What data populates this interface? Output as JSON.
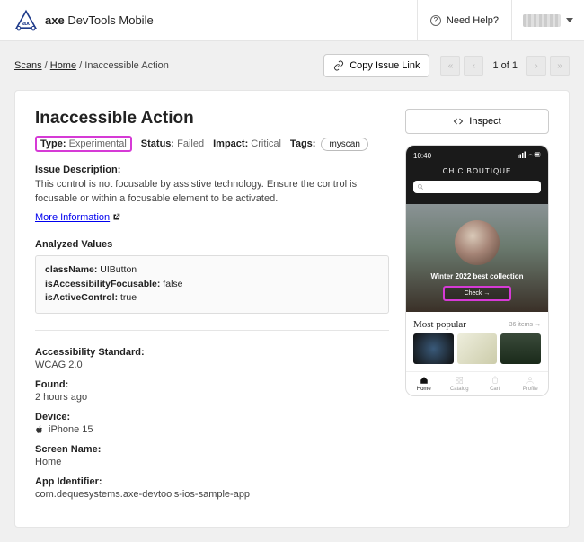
{
  "brand": {
    "strong": "axe",
    "light": " DevTools Mobile"
  },
  "help": {
    "label": "Need Help?"
  },
  "breadcrumbs": {
    "scans": "Scans",
    "home": "Home",
    "current": "Inaccessible Action",
    "sep": " / "
  },
  "actions": {
    "copy": "Copy Issue Link",
    "inspect": "Inspect"
  },
  "pager": {
    "label": "1 of 1"
  },
  "issue": {
    "title": "Inaccessible Action",
    "type_label": "Type:",
    "type_val": "Experimental",
    "status_label": "Status:",
    "status_val": "Failed",
    "impact_label": "Impact:",
    "impact_val": "Critical",
    "tags_label": "Tags:",
    "tag1": "myscan",
    "desc_hd": "Issue Description:",
    "desc": "This control is not focusable by assistive technology. Ensure the control is focusable or within a focusable element to be activated.",
    "more": "More Information",
    "analyzed_hd": "Analyzed Values",
    "av": {
      "k1": "className:",
      "v1": " UIButton",
      "k2": "isAccessibilityFocusable:",
      "v2": " false",
      "k3": "isActiveControl:",
      "v3": " true"
    },
    "std_k": "Accessibility Standard:",
    "std_v": "WCAG 2.0",
    "found_k": "Found:",
    "found_v": "2 hours ago",
    "device_k": "Device:",
    "device_v": "iPhone 15",
    "screen_k": "Screen Name:",
    "screen_v": "Home",
    "appid_k": "App Identifier:",
    "appid_v": "com.dequesystems.axe-devtools-ios-sample-app"
  },
  "phone": {
    "time": "10:40",
    "title": "CHIC BOUTIQUE",
    "hero_text": "Winter 2022 best collection",
    "hero_btn": "Check →",
    "popular": "Most popular",
    "count": "36 items →",
    "tabs": {
      "home": "Home",
      "catalog": "Catalog",
      "cart": "Cart",
      "profile": "Profile"
    }
  }
}
